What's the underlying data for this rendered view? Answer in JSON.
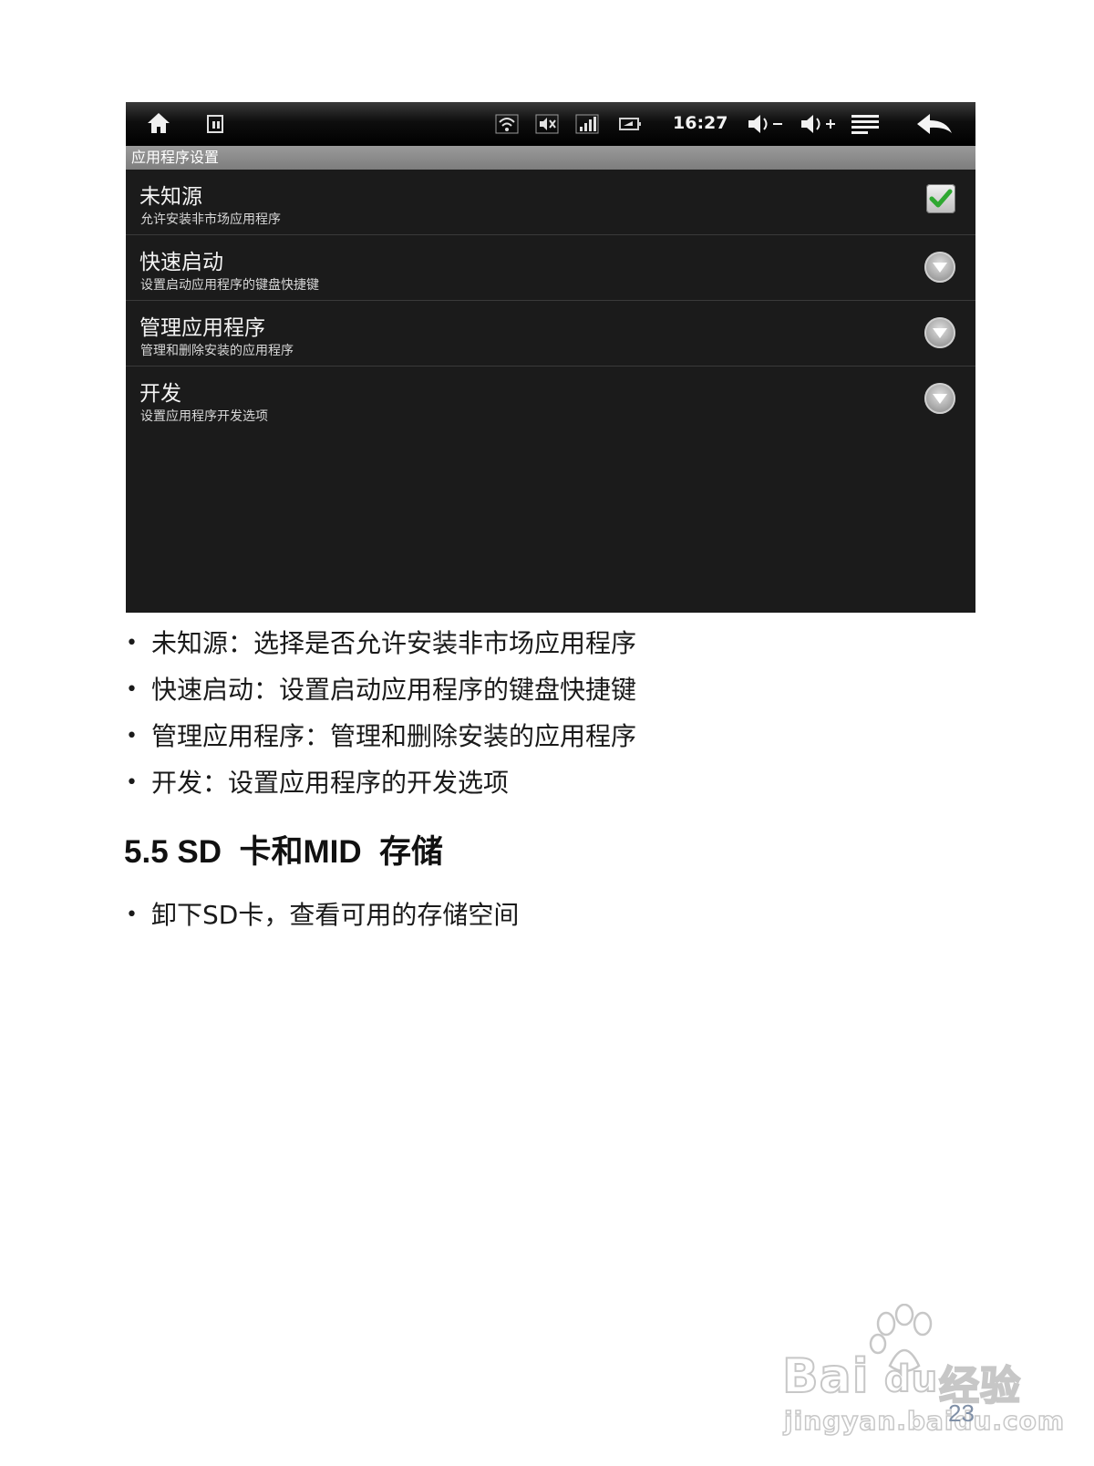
{
  "device": {
    "status_bar": {
      "icons": {
        "home": "home-icon",
        "screenshot": "screenshot-icon",
        "wifi": "wifi-icon",
        "mute": "mute-icon",
        "signal": "signal-icon",
        "battery": "battery-icon",
        "volume_down": "volume-down-icon",
        "volume_up": "volume-up-icon",
        "menu": "menu-icon",
        "back": "back-icon"
      },
      "time": "16:27"
    },
    "screen_title": "应用程序设置",
    "settings": [
      {
        "title": "未知源",
        "summary": "允许安装非市场应用程序",
        "control": "checkbox",
        "checked": true
      },
      {
        "title": "快速启动",
        "summary": "设置启动应用程序的键盘快捷键",
        "control": "chevron"
      },
      {
        "title": "管理应用程序",
        "summary": "管理和删除安装的应用程序",
        "control": "chevron"
      },
      {
        "title": "开发",
        "summary": "设置应用程序开发选项",
        "control": "chevron"
      }
    ],
    "colors": {
      "background": "#1b1b1b",
      "check_green": "#2fa832"
    }
  },
  "bullets": [
    "未知源：选择是否允许安装非市场应用程序",
    "快速启动：设置启动应用程序的键盘快捷键",
    "管理应用程序：管理和删除安装的应用程序",
    "开发：设置应用程序的开发选项"
  ],
  "section": {
    "heading": "5.5 SD  卡和MID  存储",
    "bullets": [
      "卸下SD卡，查看可用的存储空间"
    ]
  },
  "bullet_glyph": "•",
  "watermark": {
    "brand": "Bai",
    "brand_suffix": "du",
    "product": "经验",
    "url": "jingyan.baidu.com"
  },
  "page_number": "23"
}
